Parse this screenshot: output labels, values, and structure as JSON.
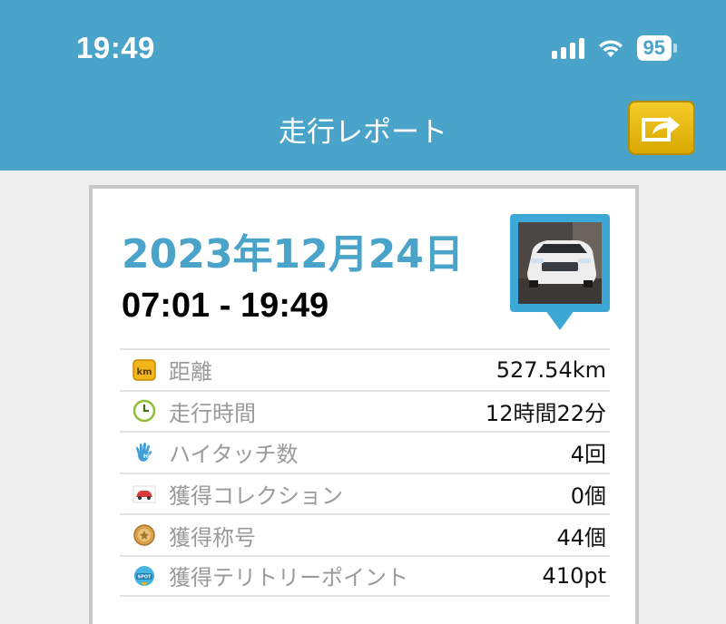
{
  "status_bar": {
    "time": "19:49",
    "battery": "95"
  },
  "header": {
    "title": "走行レポート"
  },
  "report": {
    "date": "2023年12月24日",
    "time_range": "07:01 - 19:49",
    "stats": [
      {
        "icon": "km-icon",
        "label": "距離",
        "value": "527.54km"
      },
      {
        "icon": "clock-icon",
        "label": "走行時間",
        "value": "12時間22分"
      },
      {
        "icon": "high-five-icon",
        "label": "ハイタッチ数",
        "value": "4回"
      },
      {
        "icon": "car-icon",
        "label": "獲得コレクション",
        "value": "0個"
      },
      {
        "icon": "medal-icon",
        "label": "獲得称号",
        "value": "44個"
      },
      {
        "icon": "spot-icon",
        "label": "獲得テリトリーポイント",
        "value": "410pt"
      }
    ]
  },
  "colors": {
    "header_bg": "#4aa3c9",
    "date_text": "#4aa3c9",
    "share_button": "#e3b80f"
  }
}
